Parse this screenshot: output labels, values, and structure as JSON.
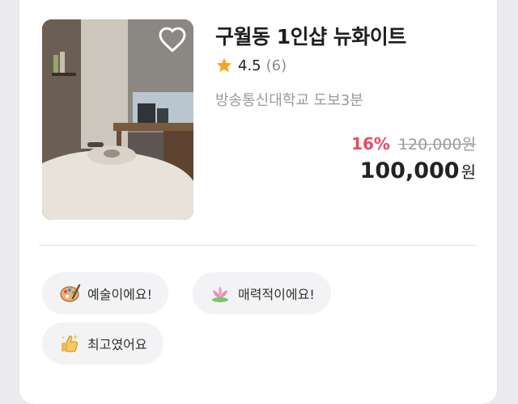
{
  "listing": {
    "title": "구월동 1인샵 뉴화이트",
    "rating": "4.5",
    "review_count": "(6)",
    "location": "방송통신대학교 도보3분",
    "discount": "16%",
    "original_price": "120,000원",
    "price": "100,000",
    "currency": "원",
    "favorited": false
  },
  "tags": [
    {
      "label": "예술이에요!",
      "icon": "art-emoji-icon"
    },
    {
      "label": "매력적이에요!",
      "icon": "lotus-emoji-icon"
    },
    {
      "label": "최고였어요",
      "icon": "thumbs-up-sparkle-emoji-icon"
    }
  ],
  "colors": {
    "discount": "#f0455c",
    "star": "#f5a623",
    "chip_bg": "#f3f3f5"
  }
}
